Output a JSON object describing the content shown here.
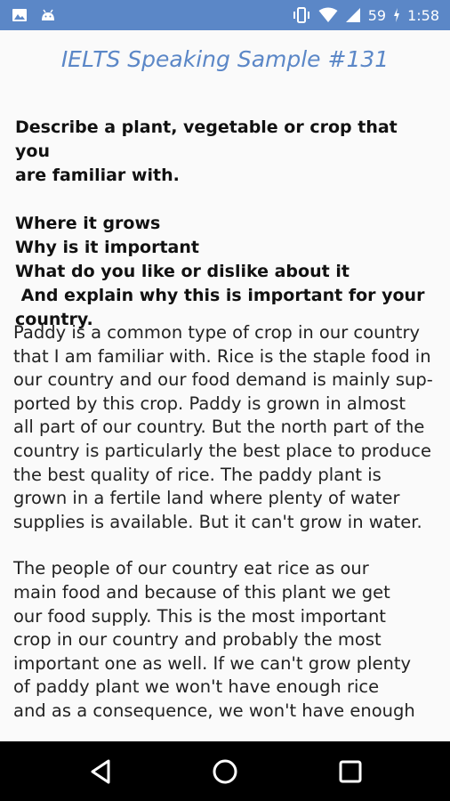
{
  "status_bar": {
    "left_icons": [
      "image-icon",
      "android-icon"
    ],
    "right_icons": [
      "vibrate-icon",
      "wifi-icon",
      "signal-icon"
    ],
    "battery": "59",
    "time": "1:58",
    "colors": {
      "background": "#5b87c7"
    }
  },
  "header": {
    "title": "IELTS Speaking Sample #131"
  },
  "question": {
    "lines": [
      "Describe a plant, vegetable or crop that you",
      "are familiar with.",
      "",
      "Where it grows",
      "Why is it important",
      "What do you like or dislike about it",
      " And explain why this is important for your",
      "country."
    ]
  },
  "answer": {
    "paragraph1": [
      "Paddy is a common type of crop in our country",
      "that I am familiar with. Rice is the staple food in",
      "our country and our food demand is mainly sup-",
      "ported by this crop. Paddy is grown in almost",
      "all part of our country. But the north part of the",
      "country is particularly the best place to produce",
      "the best quality of rice. The paddy plant is",
      "grown in a fertile land where plenty of water",
      "supplies is available. But it can't grow in water."
    ],
    "paragraph2": [
      "The people of our country eat rice as our",
      "main food and because of this plant we get",
      "our food supply. This is the most important",
      "crop in our country and probably the most",
      "important one as well. If we can't grow plenty",
      "of paddy plant we won't have enough rice",
      "and as a consequence, we won't have enough"
    ]
  },
  "nav_bar": {
    "buttons": [
      "back-icon",
      "home-icon",
      "recents-icon"
    ]
  }
}
